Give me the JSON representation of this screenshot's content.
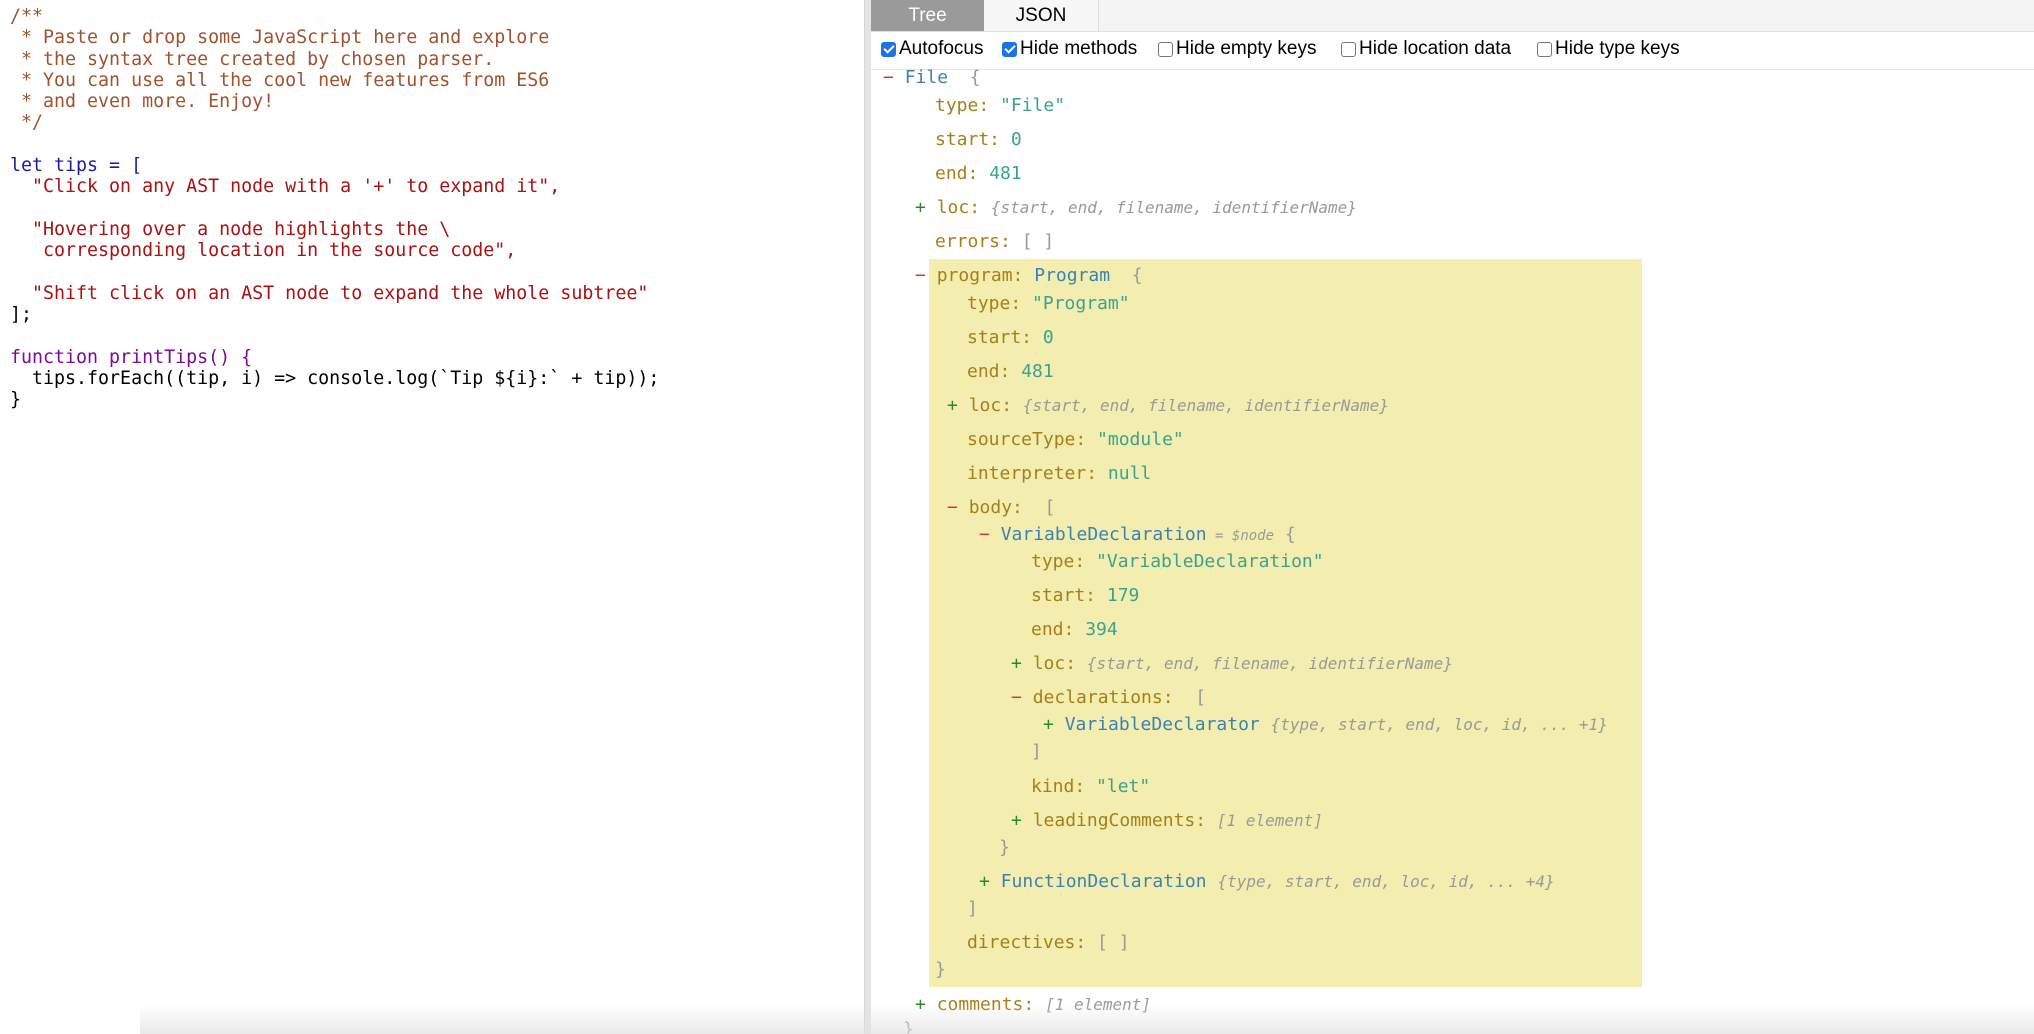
{
  "editor": {
    "lines": [
      "/**",
      " * Paste or drop some JavaScript here and explore",
      " * the syntax tree created by chosen parser.",
      " * You can use all the cool new features from ES6",
      " * and even more. Enjoy!",
      " */",
      "",
      "let tips = [",
      "  \"Click on any AST node with a '+' to expand it\",",
      "",
      "  \"Hovering over a node highlights the \\",
      "   corresponding location in the source code\",",
      "",
      "  \"Shift click on an AST node to expand the whole subtree\"",
      "];",
      "",
      "function printTips() {",
      "  tips.forEach((tip, i) => console.log(`Tip ${i}:` + tip));",
      "}"
    ]
  },
  "tabs": {
    "tree": "Tree",
    "json": "JSON"
  },
  "options": [
    {
      "label": "Autofocus",
      "checked": true
    },
    {
      "label": "Hide methods",
      "checked": true
    },
    {
      "label": "Hide empty keys",
      "checked": false
    },
    {
      "label": "Hide location data",
      "checked": false
    },
    {
      "label": "Hide type keys",
      "checked": false
    }
  ],
  "tree": {
    "root": "File",
    "file": {
      "type": "\"File\"",
      "start": "0",
      "end": "481",
      "loc_summary": "{start, end, filename, identifierName}",
      "errors": "[ ]",
      "program_type_name": "Program",
      "comments_summary": "[1 element]"
    },
    "program": {
      "type": "\"Program\"",
      "start": "0",
      "end": "481",
      "loc_summary": "{start, end, filename, identifierName}",
      "sourceType": "\"module\"",
      "interpreter": "null",
      "directives": "[ ]"
    },
    "var_decl": {
      "name": "VariableDeclaration",
      "node_hint": "= $node",
      "type": "\"VariableDeclaration\"",
      "start": "179",
      "end": "394",
      "loc_summary": "{start, end, filename, identifierName}",
      "declarator_name": "VariableDeclarator",
      "declarator_summary": "{type, start, end, loc, id, ... +1}",
      "kind": "\"let\"",
      "leading_comments_summary": "[1 element]"
    },
    "func_decl": {
      "name": "FunctionDeclaration",
      "summary": "{type, start, end, loc, id, ... +4}"
    }
  }
}
